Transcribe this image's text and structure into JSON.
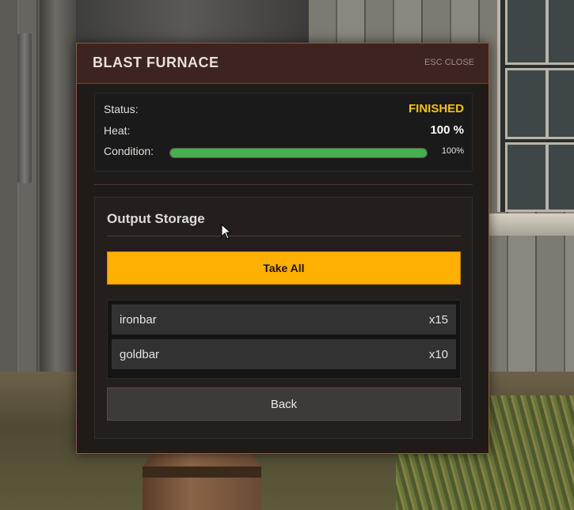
{
  "panel": {
    "title": "BLAST FURNACE",
    "close_hint": "ESC CLOSE"
  },
  "status": {
    "status_label": "Status:",
    "status_value": "FINISHED",
    "heat_label": "Heat:",
    "heat_value": "100 %",
    "condition_label": "Condition:",
    "condition_percent": "100%",
    "condition_fraction": 1.0
  },
  "storage": {
    "title": "Output Storage",
    "take_all_label": "Take All",
    "items": [
      {
        "name": "ironbar",
        "qty": "x15"
      },
      {
        "name": "goldbar",
        "qty": "x10"
      }
    ],
    "back_label": "Back"
  },
  "colors": {
    "accent": "#ffb000",
    "status_finished": "#f2c21a",
    "condition_bar": "#47b04d",
    "header_bg": "#3e2421"
  },
  "icons": [
    "mouse-cursor-icon"
  ]
}
